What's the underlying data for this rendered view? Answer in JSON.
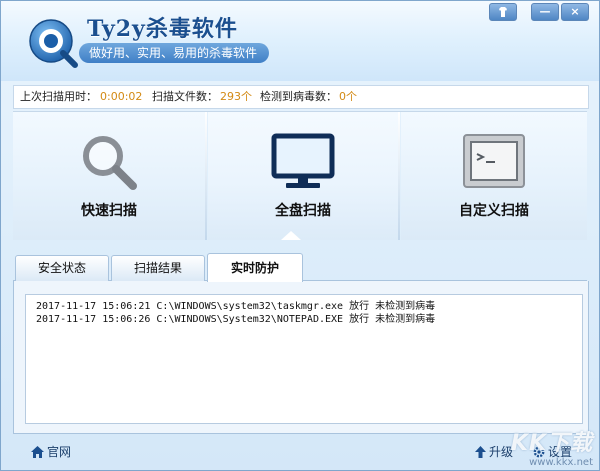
{
  "app": {
    "title": "Ty2y杀毒软件",
    "slogan": "做好用、实用、易用的杀毒软件"
  },
  "window_controls": {
    "skin": "skin-icon",
    "minimize": "—",
    "close": "×"
  },
  "status": {
    "last_scan_label": "上次扫描用时：",
    "last_scan_value": "0:00:02",
    "files_label": "扫描文件数：",
    "files_value": "293个",
    "virus_label": "检测到病毒数：",
    "virus_value": "0个"
  },
  "scan_buttons": [
    {
      "label": "快速扫描",
      "icon": "magnifier-icon"
    },
    {
      "label": "全盘扫描",
      "icon": "monitor-icon"
    },
    {
      "label": "自定义扫描",
      "icon": "terminal-icon"
    }
  ],
  "tabs": [
    {
      "label": "安全状态",
      "active": false
    },
    {
      "label": "扫描结果",
      "active": false
    },
    {
      "label": "实时防护",
      "active": true
    }
  ],
  "log": [
    "2017-11-17 15:06:21 C:\\WINDOWS\\system32\\taskmgr.exe 放行 未检测到病毒",
    "2017-11-17 15:06:26 C:\\WINDOWS\\System32\\NOTEPAD.EXE 放行 未检测到病毒"
  ],
  "footer": {
    "website": "官网",
    "upgrade": "升级",
    "settings": "设置"
  },
  "watermark": {
    "logo_text": "KK下载",
    "url": "www.kkx.net"
  },
  "colors": {
    "accent": "#1b4f8f",
    "highlight": "#d38a15"
  }
}
